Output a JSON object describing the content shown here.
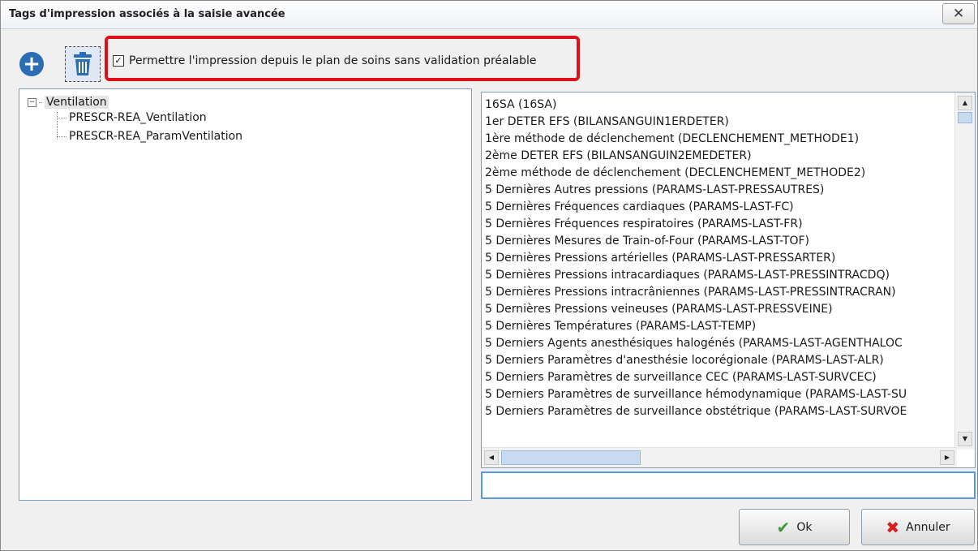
{
  "window": {
    "title": "Tags d'impression associés à la saisie avancée",
    "close_glyph": "✕"
  },
  "toolbar": {
    "add_icon": "plus-circle-icon",
    "delete_icon": "trash-icon",
    "checkbox_label": "Permettre l'impression depuis le plan de soins sans validation préalable",
    "checkbox_checked": true,
    "checkbox_glyph": "✓",
    "highlight_color": "#e0101b"
  },
  "tree": {
    "root": {
      "label": "Ventilation",
      "expanded_glyph": "−",
      "children": [
        "PRESCR-REA_Ventilation",
        "PRESCR-REA_ParamVentilation"
      ]
    }
  },
  "tag_list": {
    "items": [
      "16SA (16SA)",
      "1er DETER EFS (BILANSANGUIN1ERDETER)",
      "1ère méthode de déclenchement (DECLENCHEMENT_METHODE1)",
      "2ème DETER EFS (BILANSANGUIN2EMEDETER)",
      "2ème méthode de déclenchement (DECLENCHEMENT_METHODE2)",
      "5 Dernières Autres pressions (PARAMS-LAST-PRESSAUTRES)",
      "5 Dernières Fréquences cardiaques (PARAMS-LAST-FC)",
      "5 Dernières Fréquences respiratoires (PARAMS-LAST-FR)",
      "5 Dernières Mesures de Train-of-Four (PARAMS-LAST-TOF)",
      "5 Dernières Pressions artérielles (PARAMS-LAST-PRESSARTER)",
      "5 Dernières Pressions intracardiaques (PARAMS-LAST-PRESSINTRACDQ)",
      "5 Dernières Pressions intracrâniennes (PARAMS-LAST-PRESSINTRACRAN)",
      "5 Dernières Pressions veineuses (PARAMS-LAST-PRESSVEINE)",
      "5 Dernières Températures (PARAMS-LAST-TEMP)",
      "5 Derniers Agents anesthésiques halogénés (PARAMS-LAST-AGENTHALOC",
      "5 Derniers Paramètres d'anesthésie locorégionale (PARAMS-LAST-ALR)",
      "5 Derniers Paramètres de surveillance CEC (PARAMS-LAST-SURVCEC)",
      "5 Derniers Paramètres de surveillance hémodynamique (PARAMS-LAST-SU",
      "5 Derniers Paramètres de surveillance obstétrique (PARAMS-LAST-SURVOE"
    ],
    "scroll_up_glyph": "▲",
    "scroll_down_glyph": "▼",
    "scroll_left_glyph": "◀",
    "scroll_right_glyph": "▶"
  },
  "search": {
    "value": ""
  },
  "footer": {
    "ok_label": "Ok",
    "ok_icon": "checkmark-icon",
    "ok_glyph": "✔",
    "cancel_label": "Annuler",
    "cancel_icon": "x-icon",
    "cancel_glyph": "✖"
  }
}
